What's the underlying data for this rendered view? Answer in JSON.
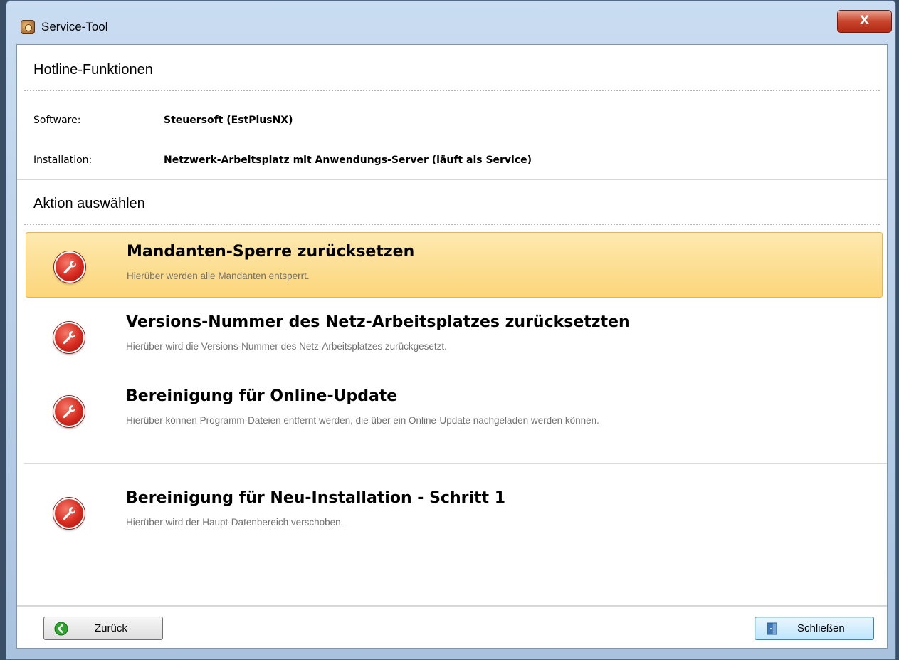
{
  "window": {
    "title": "Service-Tool",
    "close_glyph": "X"
  },
  "header": {
    "title": "Hotline-Funktionen",
    "software_label": "Software:",
    "software_value": "Steuersoft (EstPlusNX)",
    "installation_label": "Installation:",
    "installation_value": "Netzwerk-Arbeitsplatz mit Anwendungs-Server (läuft als Service)"
  },
  "actions_section": {
    "title": "Aktion auswählen",
    "items": [
      {
        "title": "Mandanten-Sperre zurücksetzen",
        "description": "Hierüber werden alle Mandanten entsperrt.",
        "icon": "wrench-icon",
        "selected": true
      },
      {
        "title": "Versions-Nummer des Netz-Arbeitsplatzes zurücksetzten",
        "description": "Hierüber wird die Versions-Nummer des Netz-Arbeitsplatzes zurückgesetzt.",
        "icon": "wrench-icon",
        "selected": false
      },
      {
        "title": "Bereinigung für Online-Update",
        "description": "Hierüber können Programm-Dateien entfernt werden, die über ein Online-Update nachgeladen werden können.",
        "icon": "wrench-icon",
        "selected": false
      },
      {
        "title": "Bereinigung für Neu-Installation - Schritt 1",
        "description": "Hierüber wird der Haupt-Datenbereich verschoben.",
        "icon": "wrench-icon",
        "selected": false
      }
    ]
  },
  "footer": {
    "back_label": "Zurück",
    "back_icon": "back-arrow-icon",
    "close_label": "Schließen",
    "close_icon": "door-exit-icon"
  },
  "colors": {
    "selected_bg": "#fcd67a",
    "action_icon": "#d52a1f",
    "title_close": "#c9452c",
    "back_icon": "#2fa52f"
  }
}
